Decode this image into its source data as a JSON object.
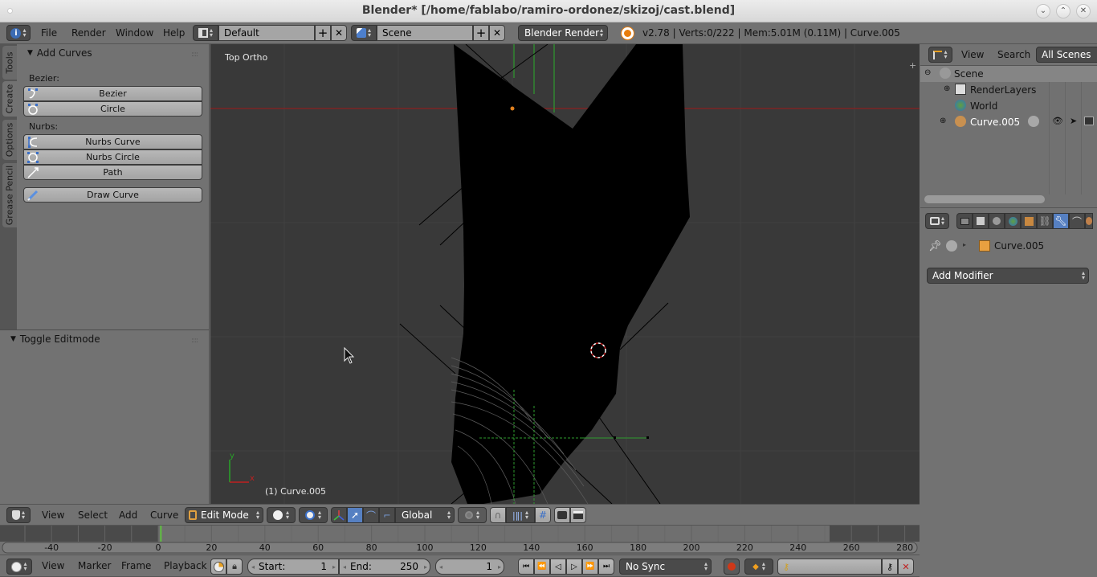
{
  "window": {
    "title": "Blender* [/home/fablabo/ramiro-ordonez/skizoj/cast.blend]",
    "controls": [
      "minimize",
      "maximize",
      "close"
    ]
  },
  "info_header": {
    "menus": [
      "File",
      "Render",
      "Window",
      "Help"
    ],
    "screen_layout": "Default",
    "scene": "Scene",
    "render_engine": "Blender Render",
    "stats": "v2.78 | Verts:0/222 | Mem:5.01M (0.11M) | Curve.005"
  },
  "tool_shelf": {
    "tabs": [
      "Tools",
      "Create",
      "Options",
      "Grease Pencil"
    ],
    "active_tab": "Create",
    "add_curves": {
      "title": "Add Curves",
      "bezier_label": "Bezier:",
      "bezier_buttons": [
        "Bezier",
        "Circle"
      ],
      "nurbs_label": "Nurbs:",
      "nurbs_buttons": [
        "Nurbs Curve",
        "Nurbs Circle",
        "Path"
      ],
      "draw_button": "Draw Curve"
    },
    "operator_panel": {
      "title": "Toggle Editmode"
    }
  },
  "viewport": {
    "view_name": "Top Ortho",
    "object_label": "(1) Curve.005",
    "axis_x": "x",
    "axis_y": "y"
  },
  "viewport_header": {
    "menus": [
      "View",
      "Select",
      "Add",
      "Curve"
    ],
    "mode": "Edit Mode",
    "transform_orientation": "Global"
  },
  "timeline": {
    "ruler_ticks": [
      "-40",
      "-20",
      "0",
      "20",
      "40",
      "60",
      "80",
      "100",
      "120",
      "140",
      "160",
      "180",
      "200",
      "220",
      "240",
      "260",
      "280"
    ],
    "current_frame": 1,
    "menus": [
      "View",
      "Marker",
      "Frame",
      "Playback"
    ],
    "start_label": "Start:",
    "start_value": "1",
    "end_label": "End:",
    "end_value": "250",
    "frame_value": "1",
    "sync": "No Sync"
  },
  "outliner": {
    "menus": [
      "View",
      "Search"
    ],
    "display_mode": "All Scenes",
    "tree": [
      {
        "label": "Scene",
        "level": 0
      },
      {
        "label": "RenderLayers",
        "level": 1
      },
      {
        "label": "World",
        "level": 1
      },
      {
        "label": "Curve.005",
        "level": 1
      }
    ]
  },
  "properties": {
    "context_tabs": [
      "render",
      "render-layers",
      "scene",
      "world",
      "object",
      "constraints",
      "modifiers",
      "data",
      "material"
    ],
    "active_tab": "modifiers",
    "breadcrumb_object": "Curve.005",
    "add_modifier_label": "Add Modifier"
  },
  "colors": {
    "accent_blue": "#5680c2",
    "x_axis": "#c02020",
    "y_axis": "#28a428",
    "vertex_orange": "#e0801e",
    "frame_cursor": "#60c040"
  }
}
